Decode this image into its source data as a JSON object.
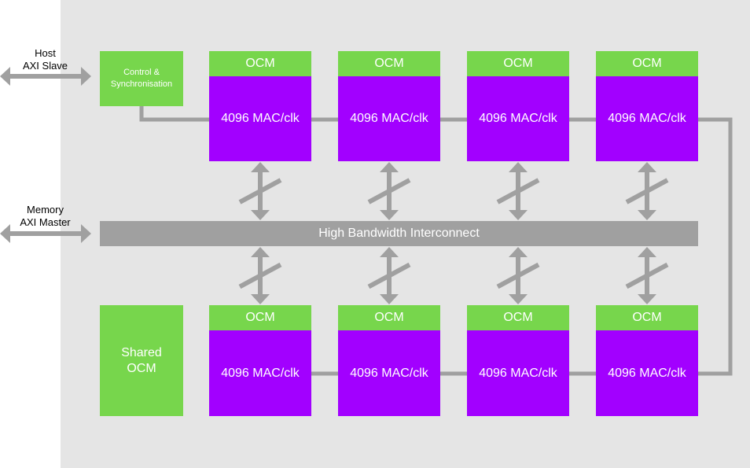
{
  "diagram": {
    "colors": {
      "background": "#e5e5e5",
      "memory": "#77d64c",
      "compute": "#a200ff",
      "interconnect": "#a0a0a0"
    },
    "host_label": "Host\nAXI Slave",
    "memory_label": "Memory\nAXI Master",
    "control_block": "Control &\nSynchronisation",
    "shared_ocm": "Shared\nOCM",
    "interconnect": "High Bandwidth Interconnect",
    "top_row": [
      {
        "ocm": "OCM",
        "mac": "4096 MAC/clk"
      },
      {
        "ocm": "OCM",
        "mac": "4096 MAC/clk"
      },
      {
        "ocm": "OCM",
        "mac": "4096 MAC/clk"
      },
      {
        "ocm": "OCM",
        "mac": "4096 MAC/clk"
      }
    ],
    "bottom_row": [
      {
        "ocm": "OCM",
        "mac": "4096 MAC/clk"
      },
      {
        "ocm": "OCM",
        "mac": "4096 MAC/clk"
      },
      {
        "ocm": "OCM",
        "mac": "4096 MAC/clk"
      },
      {
        "ocm": "OCM",
        "mac": "4096 MAC/clk"
      }
    ]
  }
}
